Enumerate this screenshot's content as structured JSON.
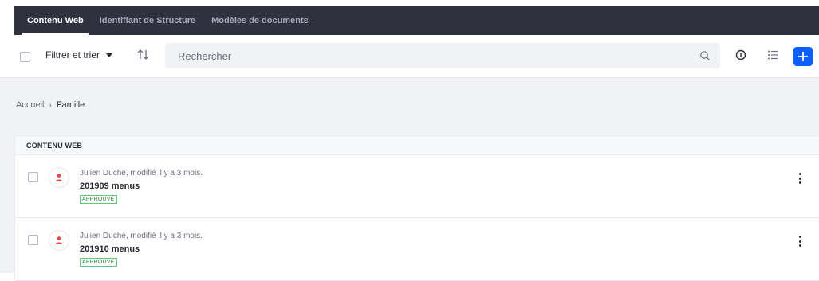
{
  "nav": {
    "tabs": [
      {
        "label": "Contenu Web",
        "active": true
      },
      {
        "label": "Identifiant de Structure",
        "active": false
      },
      {
        "label": "Modèles de documents",
        "active": false
      }
    ]
  },
  "toolbar": {
    "filter_label": "Filtrer et trier",
    "search_placeholder": "Rechercher",
    "icons": [
      "sort-icon",
      "search-icon",
      "info-icon",
      "list-view-icon",
      "plus-icon"
    ],
    "add_button_color": "#0b5fff"
  },
  "breadcrumb": {
    "items": [
      "Accueil",
      "Famille"
    ]
  },
  "list": {
    "header": "CONTENU WEB",
    "rows": [
      {
        "meta": "Julien Duché, modifié il y a 3 mois.",
        "title": "201909 menus",
        "status": "APPROUVÉ"
      },
      {
        "meta": "Julien Duché, modifié il y a 3 mois.",
        "title": "201910 menus",
        "status": "APPROUVÉ"
      }
    ]
  },
  "colors": {
    "nav_bg": "#30313f",
    "page_bg": "#f1f2f5",
    "avatar_icon": "#e5484d",
    "status_green": "#287d3c"
  }
}
